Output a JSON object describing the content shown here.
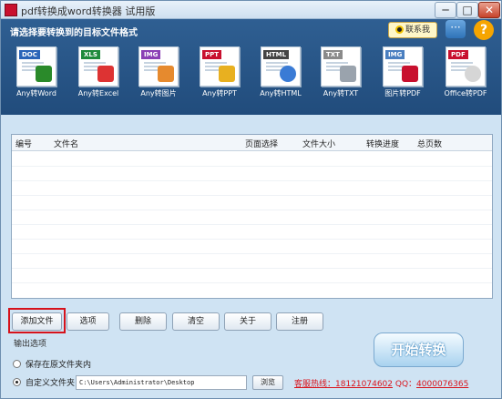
{
  "window": {
    "title": "pdf转换成word转换器 试用版",
    "min_label": "─",
    "max_label": "□",
    "close_label": "✕"
  },
  "banner": {
    "label": "请选择要转换到的目标文件格式",
    "qq_label": "联系我",
    "chat_label": "···",
    "help_label": "?"
  },
  "tools": [
    {
      "tag": "DOC",
      "label": "Any转Word",
      "tag_color": "#2a64b8",
      "mark_color": "#2a8a2a"
    },
    {
      "tag": "XLS",
      "label": "Any转Excel",
      "tag_color": "#1f8a3c",
      "mark_color": "#d33"
    },
    {
      "tag": "IMG",
      "label": "Any转图片",
      "tag_color": "#8a3fb5",
      "mark_color": "#e68a2e"
    },
    {
      "tag": "PPT",
      "label": "Any转PPT",
      "tag_color": "#c8102e",
      "mark_color": "#e8b020"
    },
    {
      "tag": "HTML",
      "label": "Any转HTML",
      "tag_color": "#444",
      "mark_color": "#3a7bd5"
    },
    {
      "tag": "TXT",
      "label": "Any转TXT",
      "tag_color": "#8a8a8a",
      "mark_color": "#9aa3ad"
    },
    {
      "tag": "IMG",
      "label": "图片转PDF",
      "tag_color": "#4a7fc0",
      "mark_color": "#c8102e"
    },
    {
      "tag": "PDF",
      "label": "Office转PDF",
      "tag_color": "#c8102e",
      "mark_color": "#d6d6d6"
    }
  ],
  "table": {
    "columns": [
      "编号",
      "文件名",
      "页面选择",
      "文件大小",
      "转换进度",
      "总页数"
    ],
    "rows": []
  },
  "buttons": {
    "add_file": "添加文件",
    "options": "选项",
    "delete": "删除",
    "clear": "清空",
    "about": "关于",
    "register": "注册"
  },
  "output": {
    "label": "输出选项",
    "save_in_source": "保存在原文件夹内",
    "custom_folder": "自定义文件夹",
    "path": "C:\\Users\\Administrator\\Desktop",
    "browse": "浏览",
    "selected": "custom"
  },
  "hotline": {
    "label": "客服热线：",
    "phone": "18121074602",
    "qq_label": " QQ：",
    "qq": "4000076365"
  },
  "start_button": "开始转换"
}
